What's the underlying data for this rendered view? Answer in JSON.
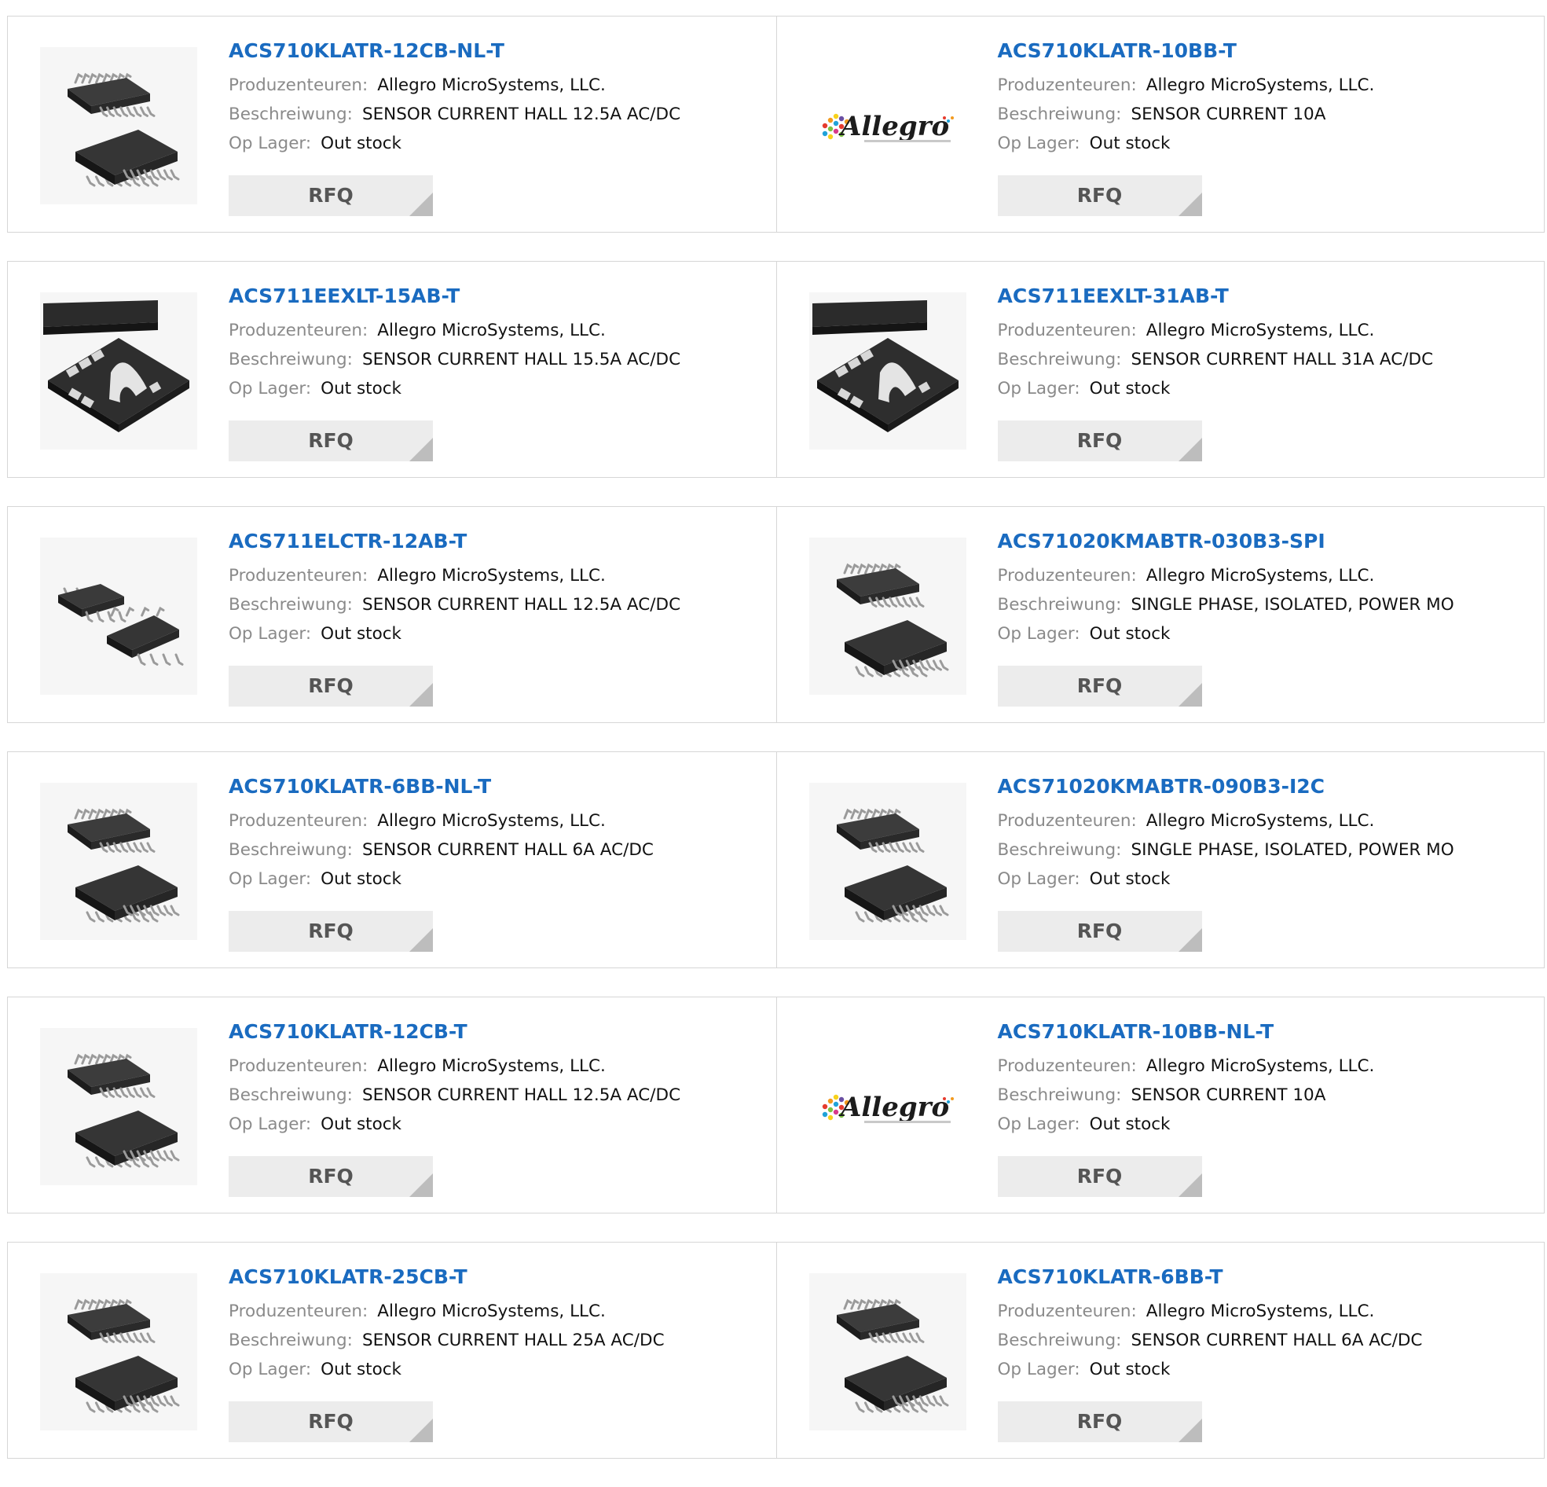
{
  "labels": {
    "manufacturer": "Produzenteuren:",
    "description": "Beschreiwung:",
    "stock": "Op Lager:",
    "rfq": "RFQ"
  },
  "colors": {
    "link": "#1a6bc0",
    "label": "#8a8a8a",
    "border": "#d6d6d6",
    "rfq_bg": "#ececec"
  },
  "products": [
    {
      "part": "ACS710KLATR-12CB-NL-T",
      "manufacturer": "Allegro MicroSystems, LLC.",
      "description": "SENSOR CURRENT HALL 12.5A AC/DC",
      "stock": "Out stock",
      "image": "soic16-icon"
    },
    {
      "part": "ACS710KLATR-10BB-T",
      "manufacturer": "Allegro MicroSystems, LLC.",
      "description": "SENSOR CURRENT 10A",
      "stock": "Out stock",
      "image": "allegro-logo"
    },
    {
      "part": "ACS711EEXLT-15AB-T",
      "manufacturer": "Allegro MicroSystems, LLC.",
      "description": "SENSOR CURRENT HALL 15.5A AC/DC",
      "stock": "Out stock",
      "image": "qfn-icon"
    },
    {
      "part": "ACS711EEXLT-31AB-T",
      "manufacturer": "Allegro MicroSystems, LLC.",
      "description": "SENSOR CURRENT HALL 31A AC/DC",
      "stock": "Out stock",
      "image": "qfn-icon"
    },
    {
      "part": "ACS711ELCTR-12AB-T",
      "manufacturer": "Allegro MicroSystems, LLC.",
      "description": "SENSOR CURRENT HALL 12.5A AC/DC",
      "stock": "Out stock",
      "image": "soic8-icon"
    },
    {
      "part": "ACS71020KMABTR-030B3-SPI",
      "manufacturer": "Allegro MicroSystems, LLC.",
      "description": "SINGLE PHASE, ISOLATED, POWER MO",
      "stock": "Out stock",
      "image": "soic16-icon"
    },
    {
      "part": "ACS710KLATR-6BB-NL-T",
      "manufacturer": "Allegro MicroSystems, LLC.",
      "description": "SENSOR CURRENT HALL 6A AC/DC",
      "stock": "Out stock",
      "image": "soic16-icon"
    },
    {
      "part": "ACS71020KMABTR-090B3-I2C",
      "manufacturer": "Allegro MicroSystems, LLC.",
      "description": "SINGLE PHASE, ISOLATED, POWER MO",
      "stock": "Out stock",
      "image": "soic16-icon"
    },
    {
      "part": "ACS710KLATR-12CB-T",
      "manufacturer": "Allegro MicroSystems, LLC.",
      "description": "SENSOR CURRENT HALL 12.5A AC/DC",
      "stock": "Out stock",
      "image": "soic16-icon"
    },
    {
      "part": "ACS710KLATR-10BB-NL-T",
      "manufacturer": "Allegro MicroSystems, LLC.",
      "description": "SENSOR CURRENT 10A",
      "stock": "Out stock",
      "image": "allegro-logo"
    },
    {
      "part": "ACS710KLATR-25CB-T",
      "manufacturer": "Allegro MicroSystems, LLC.",
      "description": "SENSOR CURRENT HALL 25A AC/DC",
      "stock": "Out stock",
      "image": "soic16-icon"
    },
    {
      "part": "ACS710KLATR-6BB-T",
      "manufacturer": "Allegro MicroSystems, LLC.",
      "description": "SENSOR CURRENT HALL 6A AC/DC",
      "stock": "Out stock",
      "image": "soic16-icon"
    }
  ]
}
